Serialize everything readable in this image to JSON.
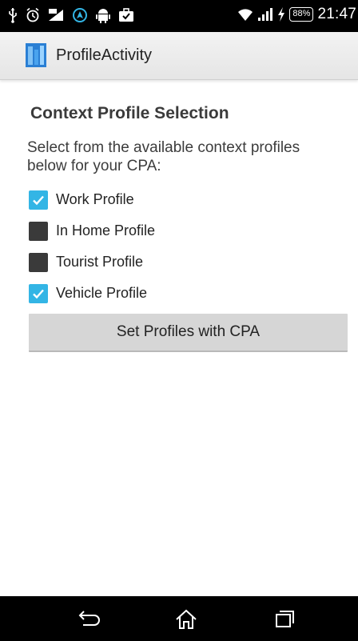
{
  "status_bar": {
    "battery_level": "88%",
    "time": "21:47"
  },
  "action_bar": {
    "title": "ProfileActivity"
  },
  "content": {
    "section_title": "Context Profile Selection",
    "description": "Select from the available context profiles below for your CPA:",
    "profiles": [
      {
        "label": "Work Profile",
        "checked": true
      },
      {
        "label": "In Home Profile",
        "checked": false
      },
      {
        "label": "Tourist Profile",
        "checked": false
      },
      {
        "label": "Vehicle Profile",
        "checked": true
      }
    ],
    "button_label": "Set Profiles with CPA"
  },
  "colors": {
    "checkbox_checked": "#33b5e5",
    "checkbox_unchecked": "#3a3a3a",
    "action_bar_bg": "#ececec",
    "button_bg": "#d6d6d6"
  },
  "icons": {
    "status_left": [
      "usb-icon",
      "alarm-icon",
      "data-icon",
      "nav-arrow-icon",
      "android-icon",
      "briefcase-icon"
    ],
    "status_right": [
      "wifi-icon",
      "signal-icon",
      "charging-icon",
      "battery-icon"
    ],
    "navigation": [
      "back-icon",
      "home-icon",
      "recents-icon"
    ]
  }
}
